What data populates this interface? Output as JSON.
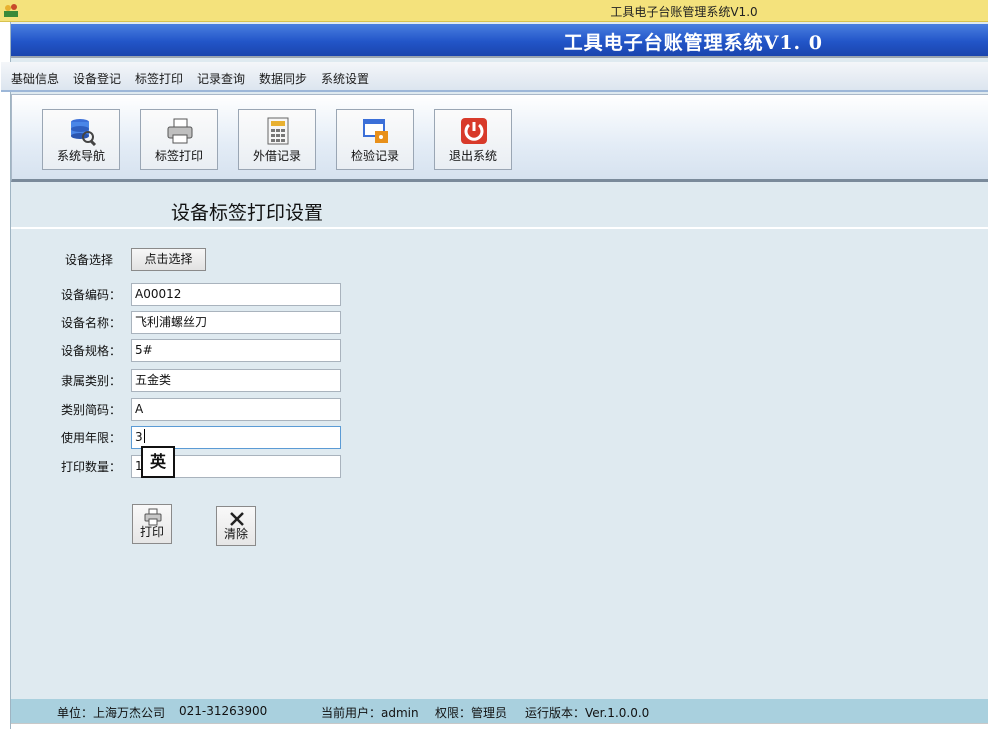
{
  "window": {
    "title": "工具电子台账管理系统V1.0"
  },
  "banner": {
    "title": "工具电子台账管理系统V1. 0"
  },
  "menu": [
    {
      "label": "基础信息"
    },
    {
      "label": "设备登记"
    },
    {
      "label": "标签打印"
    },
    {
      "label": "记录查询"
    },
    {
      "label": "数据同步"
    },
    {
      "label": "系统设置"
    }
  ],
  "toolbar": [
    {
      "label": "系统导航",
      "icon": "database-search-icon"
    },
    {
      "label": "标签打印",
      "icon": "printer-icon"
    },
    {
      "label": "外借记录",
      "icon": "calculator-icon"
    },
    {
      "label": "检验记录",
      "icon": "window-box-icon"
    },
    {
      "label": "退出系统",
      "icon": "power-icon"
    }
  ],
  "form": {
    "title": "设备标签打印设置",
    "select_label": "设备选择",
    "select_button": "点击选择",
    "fields": [
      {
        "label": "设备编码：",
        "value": "A00012"
      },
      {
        "label": "设备名称：",
        "value": "飞利浦螺丝刀"
      },
      {
        "label": "设备规格：",
        "value": "5#"
      },
      {
        "label": "隶属类别：",
        "value": "五金类"
      },
      {
        "label": "类别简码：",
        "value": "A"
      },
      {
        "label": "使用年限：",
        "value": "3"
      },
      {
        "label": "打印数量：",
        "value": "1"
      }
    ],
    "ime_indicator": "英",
    "print_button": "打印",
    "clear_button": "清除"
  },
  "status": {
    "unit": "单位：上海万杰公司",
    "phone": "021-31263900",
    "user": "当前用户：admin",
    "role": "权限：管理员",
    "version": "运行版本：Ver.1.0.0.0"
  }
}
